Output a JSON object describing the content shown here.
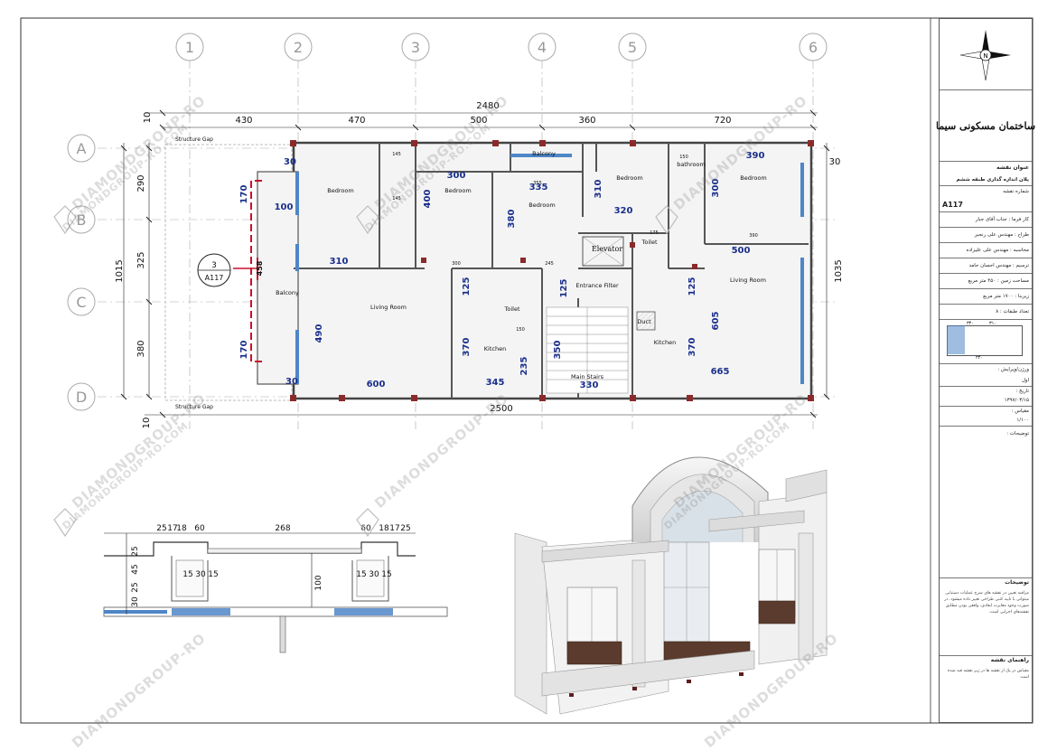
{
  "grid": {
    "columns": [
      "1",
      "2",
      "3",
      "4",
      "5",
      "6"
    ],
    "rows": [
      "A",
      "B",
      "C",
      "D"
    ]
  },
  "dims_top": {
    "overall": "2480",
    "segments": [
      "430",
      "470",
      "500",
      "360",
      "720"
    ],
    "left_gap": "10"
  },
  "dims_bottom": {
    "overall": "2500",
    "left_gap": "10"
  },
  "dims_left": {
    "overall": "1015",
    "segments": [
      "290",
      "325",
      "380"
    ]
  },
  "dims_right": {
    "overall": "1035",
    "top": "30"
  },
  "plan_labels": {
    "structure_gap_top": "Structure Gap",
    "structure_gap_bottom": "Structure Gap",
    "section_number": "3",
    "section_sheet": "A117",
    "rooms": [
      "Bedroom",
      "Bedroom",
      "Bedroom",
      "Bedroom",
      "Bedroom",
      "Balcony",
      "Balcony",
      "Living Room",
      "Living Room",
      "Kitchen",
      "Kitchen",
      "Toilet",
      "Toilet",
      "bathroom",
      "Elevator",
      "Entrance Filter",
      "Duct",
      "Main Stairs"
    ],
    "interior_dims": [
      "30",
      "170",
      "100",
      "458",
      "170",
      "490",
      "30",
      "310",
      "600",
      "300",
      "400",
      "380",
      "345",
      "235",
      "125",
      "370",
      "145",
      "145",
      "335",
      "310",
      "320",
      "245",
      "300",
      "350",
      "125",
      "150",
      "330",
      "150",
      "390",
      "300",
      "390",
      "175",
      "500",
      "125",
      "605",
      "370",
      "665",
      "30",
      "175",
      "150",
      "355"
    ]
  },
  "detail": {
    "top_dims": [
      "25",
      "17",
      "18",
      "60",
      "268",
      "60",
      "18",
      "17",
      "25"
    ],
    "left_dims": [
      "25",
      "45",
      "25",
      "30"
    ],
    "inner_dims": [
      "15",
      "30",
      "15",
      "15",
      "30",
      "15"
    ],
    "depth": "100"
  },
  "title_block": {
    "project_title": "ساختمان مسکونی سیما",
    "sheet_title_label": "عنوان نقشه",
    "sheet_title": "پلان اندازه گذاری طبقه ششم",
    "sheet_no_label": "شماره نقشه",
    "sheet_no": "A117",
    "employer": "کار فرما : جناب آقای جبار",
    "designer": "طراح : مهندس علی رنجبر",
    "calc": "محاسبه : مهندس علی علیزاده",
    "drafter": "ترسیم : مهندس احسان حامد",
    "land_area": "مساحت زمین : ۴۵۰ متر مربع",
    "built_area": "زیربنا : ۱۷۰۰ متر مربع",
    "floors": "تعداد طبقات : ۸",
    "key_dims": [
      "۲۴۰",
      "۳۱۰",
      "۳۴۰"
    ],
    "version_label": "ورژن/ویرایش :",
    "version": "اول",
    "date_label": "تاریخ :",
    "date": "۱۳۹۷/۰۳/۱۵",
    "scale_label": "مقیاس :",
    "scale": "۱/۱۰۰",
    "desc_label": "توضیحات :",
    "notes_head": "توضیحات",
    "notes_text": "مراقبه تعیین در نقشه های شرح عملیات دستیابی میتوانی با تایید کتبی طراحی تغییر داده میشود. در صورت وجود مغایرت ابعادی، واقعی بودن مطابق نقشه‌های اجرایی است.",
    "guide_head": "راهنمای نقشه",
    "guide_text": "مقیاس در یک از نقشه ها در زیر نقشه قید شده است"
  },
  "watermark": [
    "DIAMONDGROUP-RO",
    "DIAMONDGROUP-RO.COM"
  ],
  "colors": {
    "dim_blue": "#1a2f8c",
    "red_marker": "#c8102e",
    "grid_gray": "#9a9a9a",
    "glass_blue": "#4e86c7"
  }
}
